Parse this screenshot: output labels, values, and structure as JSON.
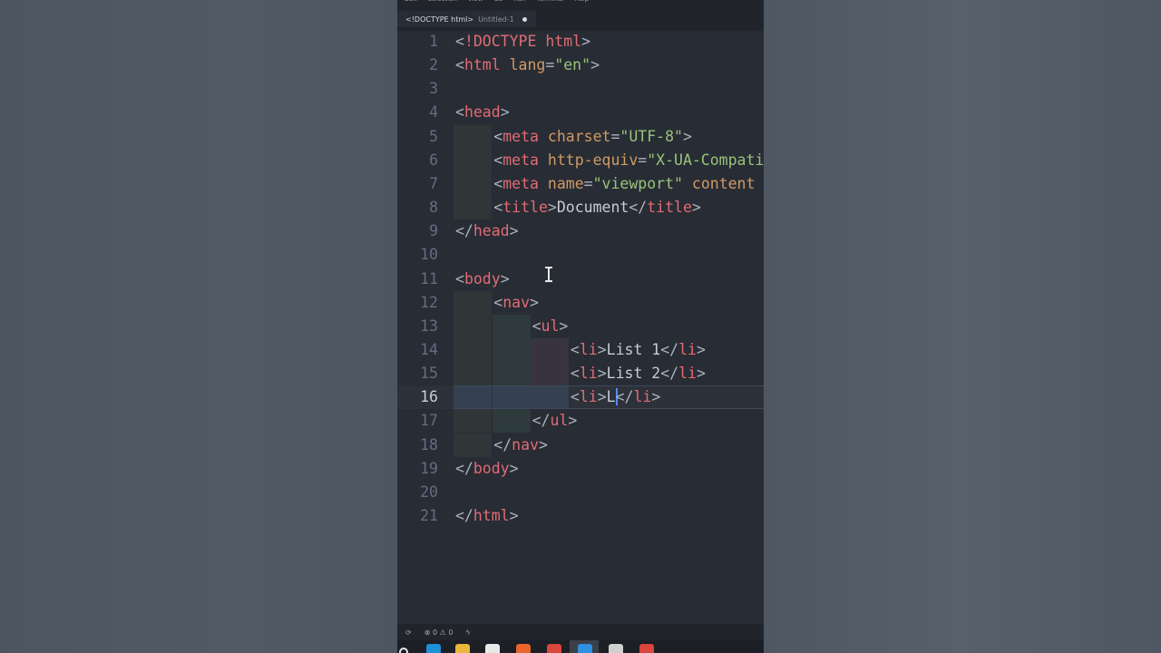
{
  "menubar": [
    "Edit",
    "Selection",
    "View",
    "Go",
    "Run",
    "Terminal",
    "Help"
  ],
  "tab": {
    "title": "<!DOCTYPE html>",
    "file": "Untitled-1"
  },
  "editor": {
    "current_line": 16,
    "lines": [
      {
        "n": "1",
        "guides": 0,
        "tokens": [
          [
            "p",
            "<"
          ],
          [
            "t",
            "!DOCTYPE"
          ],
          [
            "p",
            " "
          ],
          [
            "t",
            "html"
          ],
          [
            "p",
            ">"
          ]
        ]
      },
      {
        "n": "2",
        "guides": 0,
        "tokens": [
          [
            "p",
            "<"
          ],
          [
            "t",
            "html"
          ],
          [
            "p",
            " "
          ],
          [
            "a",
            "lang"
          ],
          [
            "p",
            "="
          ],
          [
            "s",
            "\"en\""
          ],
          [
            "p",
            ">"
          ]
        ]
      },
      {
        "n": "3",
        "guides": 0,
        "tokens": []
      },
      {
        "n": "4",
        "guides": 0,
        "tokens": [
          [
            "p",
            "<"
          ],
          [
            "t",
            "head"
          ],
          [
            "p",
            ">"
          ]
        ]
      },
      {
        "n": "5",
        "guides": 1,
        "tokens": [
          [
            "p",
            "<"
          ],
          [
            "t",
            "meta"
          ],
          [
            "p",
            " "
          ],
          [
            "a",
            "charset"
          ],
          [
            "p",
            "="
          ],
          [
            "s",
            "\"UTF-8\""
          ],
          [
            "p",
            ">"
          ]
        ]
      },
      {
        "n": "6",
        "guides": 1,
        "tokens": [
          [
            "p",
            "<"
          ],
          [
            "t",
            "meta"
          ],
          [
            "p",
            " "
          ],
          [
            "a",
            "http-equiv"
          ],
          [
            "p",
            "="
          ],
          [
            "s",
            "\"X-UA-Compatible\""
          ]
        ]
      },
      {
        "n": "7",
        "guides": 1,
        "tokens": [
          [
            "p",
            "<"
          ],
          [
            "t",
            "meta"
          ],
          [
            "p",
            " "
          ],
          [
            "a",
            "name"
          ],
          [
            "p",
            "="
          ],
          [
            "s",
            "\"viewport\""
          ],
          [
            "p",
            " "
          ],
          [
            "a",
            "content"
          ]
        ]
      },
      {
        "n": "8",
        "guides": 1,
        "tokens": [
          [
            "p",
            "<"
          ],
          [
            "t",
            "title"
          ],
          [
            "p",
            ">"
          ],
          [
            "tx",
            "Document"
          ],
          [
            "p",
            "</"
          ],
          [
            "t",
            "title"
          ],
          [
            "p",
            ">"
          ]
        ]
      },
      {
        "n": "9",
        "guides": 0,
        "tokens": [
          [
            "p",
            "</"
          ],
          [
            "t",
            "head"
          ],
          [
            "p",
            ">"
          ]
        ]
      },
      {
        "n": "10",
        "guides": 0,
        "tokens": []
      },
      {
        "n": "11",
        "guides": 0,
        "tokens": [
          [
            "p",
            "<"
          ],
          [
            "t",
            "body"
          ],
          [
            "p",
            ">"
          ]
        ]
      },
      {
        "n": "12",
        "guides": 1,
        "tokens": [
          [
            "p",
            "<"
          ],
          [
            "t",
            "nav"
          ],
          [
            "p",
            ">"
          ]
        ]
      },
      {
        "n": "13",
        "guides": 2,
        "tokens": [
          [
            "p",
            "<"
          ],
          [
            "t",
            "ul"
          ],
          [
            "p",
            ">"
          ]
        ]
      },
      {
        "n": "14",
        "guides": 3,
        "tokens": [
          [
            "p",
            "<"
          ],
          [
            "t",
            "li"
          ],
          [
            "p",
            ">"
          ],
          [
            "tx",
            "List 1"
          ],
          [
            "p",
            "</"
          ],
          [
            "t",
            "li"
          ],
          [
            "p",
            ">"
          ]
        ]
      },
      {
        "n": "15",
        "guides": 3,
        "tokens": [
          [
            "p",
            "<"
          ],
          [
            "t",
            "li"
          ],
          [
            "p",
            ">"
          ],
          [
            "tx",
            "List 2"
          ],
          [
            "p",
            "</"
          ],
          [
            "t",
            "li"
          ],
          [
            "p",
            ">"
          ]
        ]
      },
      {
        "n": "16",
        "guides": 3,
        "tokens": [
          [
            "p",
            "<"
          ],
          [
            "t",
            "li"
          ],
          [
            "p",
            ">"
          ],
          [
            "tx",
            "L"
          ],
          [
            "caret",
            ""
          ],
          [
            "p",
            "</"
          ],
          [
            "t",
            "li"
          ],
          [
            "p",
            ">"
          ]
        ]
      },
      {
        "n": "17",
        "guides": 2,
        "tokens": [
          [
            "p",
            "</"
          ],
          [
            "t",
            "ul"
          ],
          [
            "p",
            ">"
          ]
        ]
      },
      {
        "n": "18",
        "guides": 1,
        "tokens": [
          [
            "p",
            "</"
          ],
          [
            "t",
            "nav"
          ],
          [
            "p",
            ">"
          ]
        ]
      },
      {
        "n": "19",
        "guides": 0,
        "tokens": [
          [
            "p",
            "</"
          ],
          [
            "t",
            "body"
          ],
          [
            "p",
            ">"
          ]
        ]
      },
      {
        "n": "20",
        "guides": 0,
        "tokens": []
      },
      {
        "n": "21",
        "guides": 0,
        "tokens": [
          [
            "p",
            "</"
          ],
          [
            "t",
            "html"
          ],
          [
            "p",
            ">"
          ]
        ]
      }
    ]
  },
  "statusbar": {
    "errors": "0",
    "warnings": "0"
  },
  "taskbar": {
    "icons": [
      {
        "name": "search-icon",
        "color": "#e8e8e8"
      },
      {
        "name": "edge-icon",
        "color": "#1e90d8"
      },
      {
        "name": "file-explorer-icon",
        "color": "#e8b63a"
      },
      {
        "name": "store-icon",
        "color": "#e8e8e8"
      },
      {
        "name": "firefox-icon",
        "color": "#e8652b"
      },
      {
        "name": "chrome-icon",
        "color": "#d9463b"
      },
      {
        "name": "vscode-icon",
        "color": "#2f8fe0"
      },
      {
        "name": "github-icon",
        "color": "#d0d0d0"
      },
      {
        "name": "chrome-icon",
        "color": "#d9463b"
      }
    ]
  }
}
